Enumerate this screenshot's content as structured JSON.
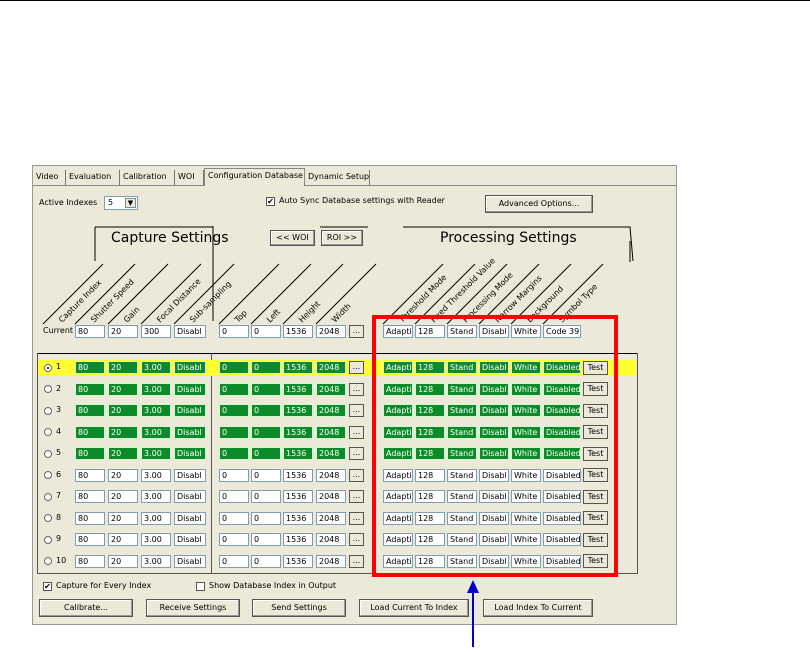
{
  "tabs": [
    "Video",
    "Evaluation",
    "Calibration",
    "WOI",
    "Configuration Database",
    "Dynamic Setup"
  ],
  "active_indexes": {
    "label": "Active Indexes",
    "value": "5"
  },
  "auto_sync": {
    "label": "Auto Sync Database settings with Reader",
    "checked": true
  },
  "advanced_btn": "Advanced Options...",
  "section": {
    "capture": "Capture Settings",
    "woi": "<< WOI",
    "roi": "ROI >>",
    "processing": "Processing Settings"
  },
  "capture_cols": [
    "Capture Index",
    "Shutter Speed",
    "Gain",
    "Focal Distance",
    "Sub-sampling"
  ],
  "window_cols": [
    "Top",
    "Left",
    "Height",
    "Width"
  ],
  "processing_cols": [
    "Threshold Mode",
    "Fixed Threshold Value",
    "Processing Mode",
    "Narrow Margins",
    "Background",
    "Symbol Type"
  ],
  "current": {
    "label": "Current",
    "capture": [
      "80",
      "20",
      "300",
      "Disabl"
    ],
    "window": [
      "0",
      "0",
      "1536",
      "2048"
    ],
    "processing": [
      "Adapti",
      "128",
      "Stand",
      "Disabl",
      "White",
      "Code 39"
    ]
  },
  "rows": [
    {
      "index": "1",
      "selected": true,
      "active": true,
      "capture": [
        "80",
        "20",
        "3.00",
        "Disabl"
      ],
      "window": [
        "0",
        "0",
        "1536",
        "2048"
      ],
      "processing": [
        "Adapti",
        "128",
        "Stand",
        "Disabl",
        "White",
        "Disabled"
      ]
    },
    {
      "index": "2",
      "selected": false,
      "active": true,
      "capture": [
        "80",
        "20",
        "3.00",
        "Disabl"
      ],
      "window": [
        "0",
        "0",
        "1536",
        "2048"
      ],
      "processing": [
        "Adapti",
        "128",
        "Stand",
        "Disabl",
        "White",
        "Disabled"
      ]
    },
    {
      "index": "3",
      "selected": false,
      "active": true,
      "capture": [
        "80",
        "20",
        "3.00",
        "Disabl"
      ],
      "window": [
        "0",
        "0",
        "1536",
        "2048"
      ],
      "processing": [
        "Adapti",
        "128",
        "Stand",
        "Disabl",
        "White",
        "Disabled"
      ]
    },
    {
      "index": "4",
      "selected": false,
      "active": true,
      "capture": [
        "80",
        "20",
        "3.00",
        "Disabl"
      ],
      "window": [
        "0",
        "0",
        "1536",
        "2048"
      ],
      "processing": [
        "Adapti",
        "128",
        "Stand",
        "Disabl",
        "White",
        "Disabled"
      ]
    },
    {
      "index": "5",
      "selected": false,
      "active": true,
      "capture": [
        "80",
        "20",
        "3.00",
        "Disabl"
      ],
      "window": [
        "0",
        "0",
        "1536",
        "2048"
      ],
      "processing": [
        "Adapti",
        "128",
        "Stand",
        "Disabl",
        "White",
        "Disabled"
      ]
    },
    {
      "index": "6",
      "selected": false,
      "active": false,
      "capture": [
        "80",
        "20",
        "3.00",
        "Disabl"
      ],
      "window": [
        "0",
        "0",
        "1536",
        "2048"
      ],
      "processing": [
        "Adapti",
        "128",
        "Stand",
        "Disabl",
        "White",
        "Disabled"
      ]
    },
    {
      "index": "7",
      "selected": false,
      "active": false,
      "capture": [
        "80",
        "20",
        "3.00",
        "Disabl"
      ],
      "window": [
        "0",
        "0",
        "1536",
        "2048"
      ],
      "processing": [
        "Adapti",
        "128",
        "Stand",
        "Disabl",
        "White",
        "Disabled"
      ]
    },
    {
      "index": "8",
      "selected": false,
      "active": false,
      "capture": [
        "80",
        "20",
        "3.00",
        "Disabl"
      ],
      "window": [
        "0",
        "0",
        "1536",
        "2048"
      ],
      "processing": [
        "Adapti",
        "128",
        "Stand",
        "Disabl",
        "White",
        "Disabled"
      ]
    },
    {
      "index": "9",
      "selected": false,
      "active": false,
      "capture": [
        "80",
        "20",
        "3.00",
        "Disabl"
      ],
      "window": [
        "0",
        "0",
        "1536",
        "2048"
      ],
      "processing": [
        "Adapti",
        "128",
        "Stand",
        "Disabl",
        "White",
        "Disabled"
      ]
    },
    {
      "index": "10",
      "selected": false,
      "active": false,
      "capture": [
        "80",
        "20",
        "3.00",
        "Disabl"
      ],
      "window": [
        "0",
        "0",
        "1536",
        "2048"
      ],
      "processing": [
        "Adapti",
        "128",
        "Stand",
        "Disabl",
        "White",
        "Disabled"
      ]
    }
  ],
  "ellipsis": "...",
  "test_label": "Test",
  "capture_every": {
    "label": "Capture for Every Index",
    "checked": true
  },
  "show_index": {
    "label": "Show Database Index in Output",
    "checked": false
  },
  "bottom_buttons": [
    "Calibrate...",
    "Receive Settings",
    "Send Settings",
    "Load Current To Index",
    "Load Index To Current"
  ],
  "colors": {
    "active_cell": "#0d8a2a",
    "highlight": "#ffff33",
    "callout": "#ff0000",
    "pointer": "#0000cc"
  }
}
